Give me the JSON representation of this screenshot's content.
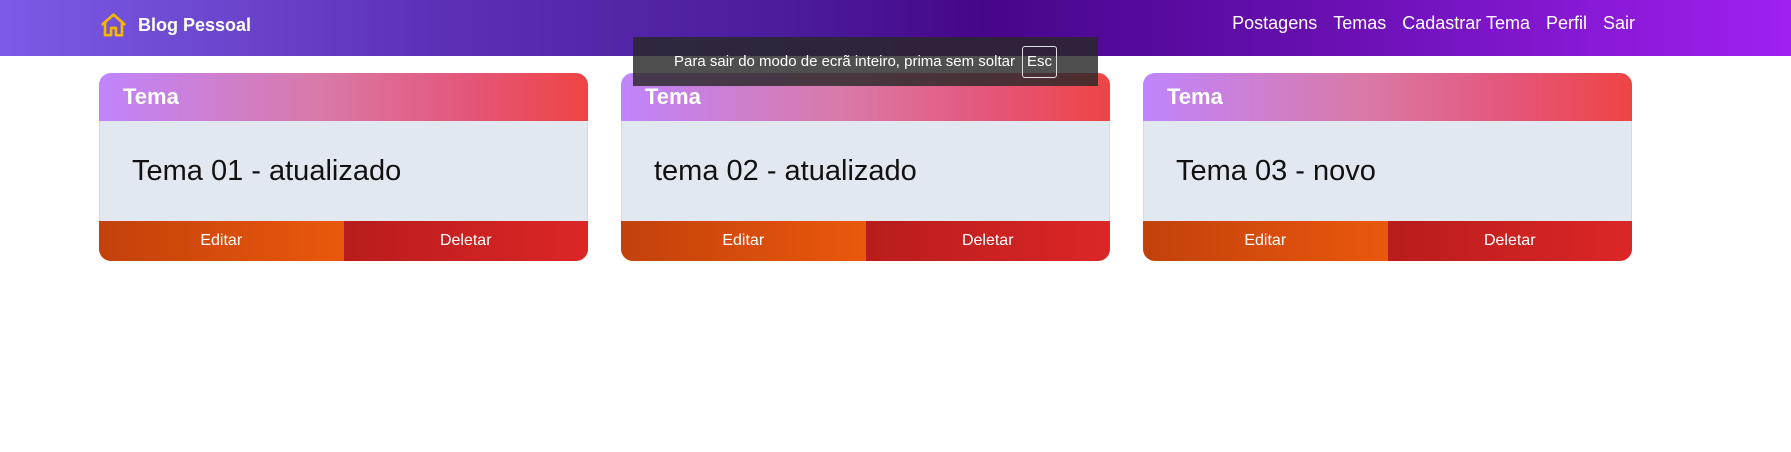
{
  "navbar": {
    "brand": "Blog Pessoal",
    "icon": "home-icon",
    "links": [
      "Postagens",
      "Temas",
      "Cadastrar Tema",
      "Perfil",
      "Sair"
    ]
  },
  "fullscreen_notice": {
    "text": "Para sair do modo de ecrã inteiro, prima sem soltar",
    "key": "Esc"
  },
  "cards": [
    {
      "header": "Tema",
      "description": "Tema 01 - atualizado",
      "edit_label": "Editar",
      "delete_label": "Deletar"
    },
    {
      "header": "Tema",
      "description": "tema 02 - atualizado",
      "edit_label": "Editar",
      "delete_label": "Deletar"
    },
    {
      "header": "Tema",
      "description": "Tema 03 - novo",
      "edit_label": "Editar",
      "delete_label": "Deletar"
    }
  ],
  "colors": {
    "navbar_start": "#7b5ce6",
    "navbar_end": "#a020f0",
    "card_header_start": "#c084fc",
    "card_header_end": "#ef4444",
    "card_body": "#e2e8f0",
    "edit_button": "#ea580c",
    "delete_button": "#dc2626",
    "home_icon": "#f5b800"
  }
}
